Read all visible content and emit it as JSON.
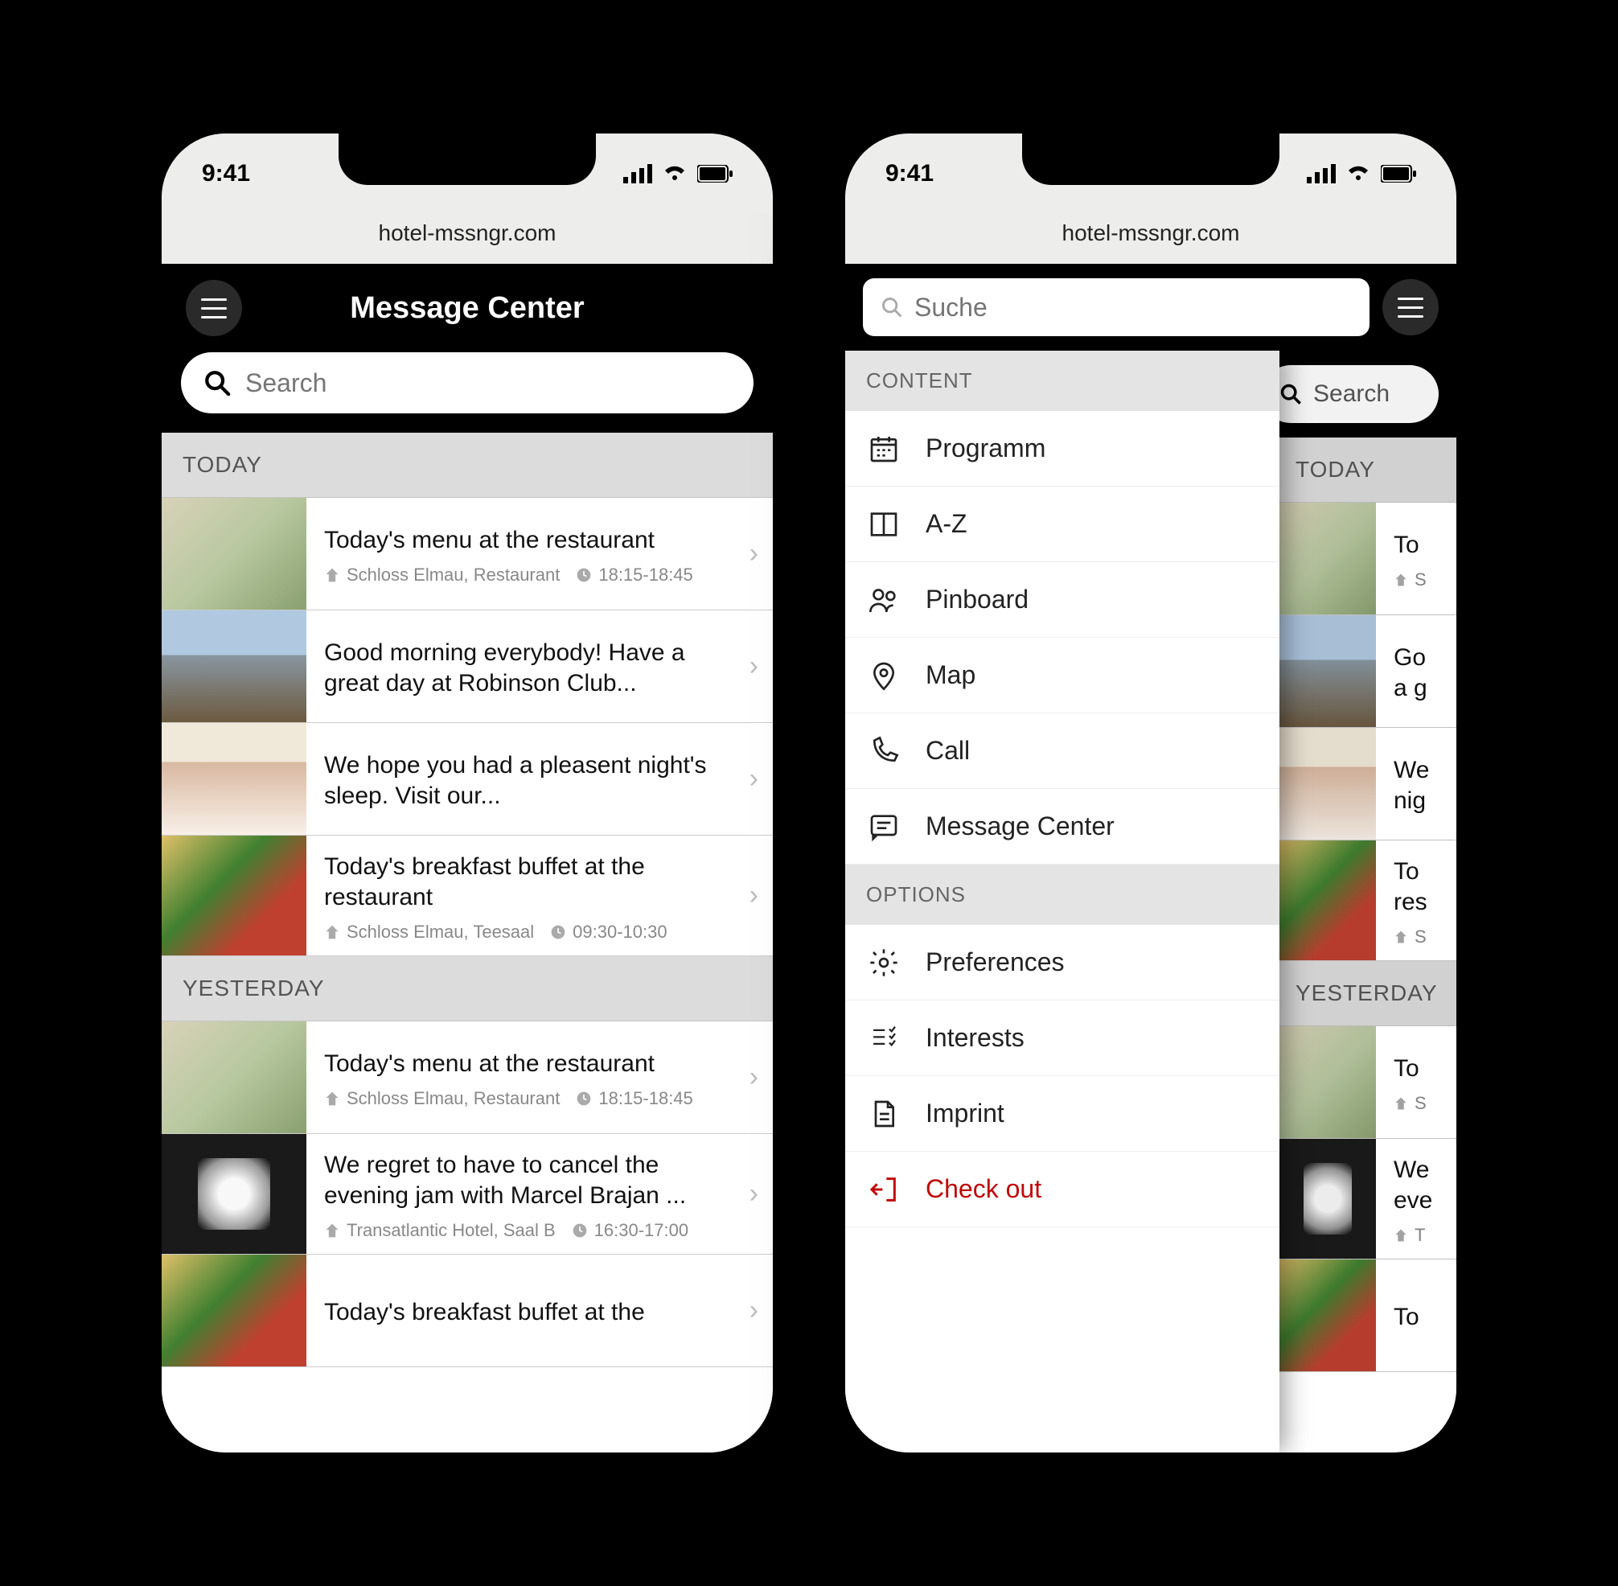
{
  "status": {
    "time": "9:41"
  },
  "url": "hotel-mssngr.com",
  "header": {
    "title": "Message Center"
  },
  "search": {
    "placeholder": "Search"
  },
  "sections": {
    "today": "TODAY",
    "yesterday": "YESTERDAY"
  },
  "today_items": [
    {
      "title": "Today's menu at the restaurant",
      "loc": "Schloss Elmau, Restaurant",
      "time": "18:15-18:45"
    },
    {
      "title": "Good morning everybody! Have a great day at Robinson Club..."
    },
    {
      "title": "We hope you had a pleasent night's sleep. Visit our..."
    },
    {
      "title": "Today's breakfast buffet at the restaurant",
      "loc": "Schloss Elmau, Teesaal",
      "time": "09:30-10:30"
    }
  ],
  "yesterday_items": [
    {
      "title": "Today's menu at the restaurant",
      "loc": "Schloss Elmau, Restaurant",
      "time": "18:15-18:45"
    },
    {
      "title": "We regret to have to cancel the evening jam with Marcel Brajan ...",
      "loc": "Transatlantic Hotel, Saal B",
      "time": "16:30-17:00"
    },
    {
      "title": "Today's breakfast buffet at the"
    }
  ],
  "drawer": {
    "search_placeholder": "Suche",
    "content_label": "CONTENT",
    "options_label": "OPTIONS",
    "content_items": [
      {
        "label": "Programm"
      },
      {
        "label": "A-Z"
      },
      {
        "label": "Pinboard"
      },
      {
        "label": "Map"
      },
      {
        "label": "Call"
      },
      {
        "label": "Message Center"
      }
    ],
    "options_items": [
      {
        "label": "Preferences"
      },
      {
        "label": "Interests"
      },
      {
        "label": "Imprint"
      },
      {
        "label": "Check out"
      }
    ]
  },
  "bg_snippets": {
    "t0": "To",
    "s0": "S",
    "t1": "Go\na g",
    "t2": "We\nnig",
    "t3": "To\nres",
    "s3": "S",
    "y0": "To",
    "y0s": "S",
    "y1": "We\neve",
    "y1s": "T",
    "y2": "To"
  }
}
